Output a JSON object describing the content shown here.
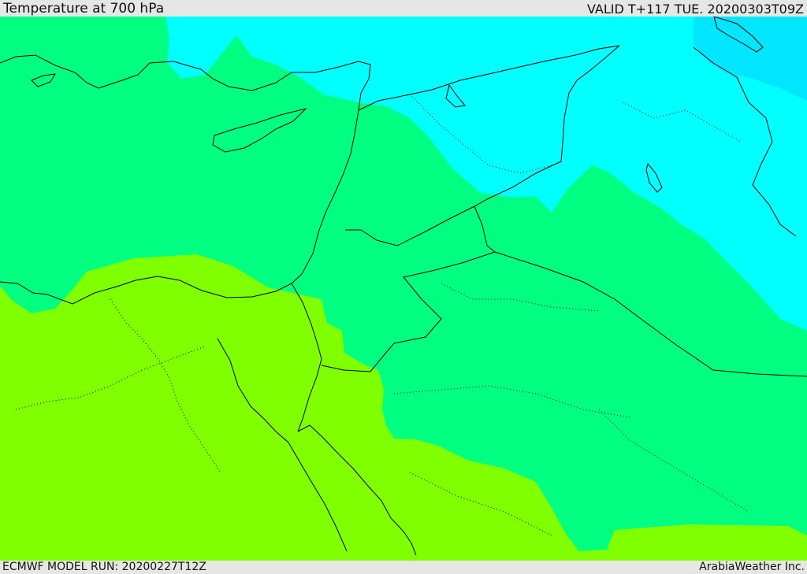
{
  "header": {
    "title": "Temperature at 700 hPa",
    "valid": "VALID T+117 TUE. 20200303T09Z"
  },
  "footer": {
    "model_run": "ECMWF MODEL RUN: 20200227T12Z",
    "credit": "ArabiaWeather Inc."
  },
  "colors": {
    "page_background": "#e6e6e6",
    "warm_band": "#80ff00",
    "mid_band": "#00ff80",
    "cool_band": "#00ffff",
    "cold_band": "#00e6ff",
    "coastlines_and_borders": "#000000"
  },
  "map": {
    "variable": "temperature",
    "level": "700 hPa",
    "bands": [
      "cold_band",
      "cool_band",
      "mid_band",
      "warm_band"
    ]
  }
}
